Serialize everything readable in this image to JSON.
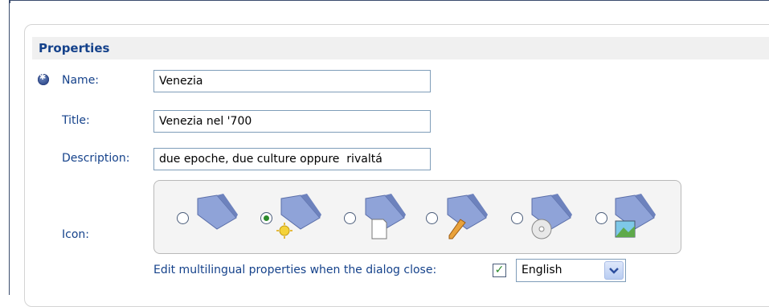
{
  "section": {
    "title": "Properties"
  },
  "fields": {
    "name": {
      "label": "Name:",
      "value": "Venezia"
    },
    "title": {
      "label": "Title:",
      "value": "Venezia nel '700"
    },
    "description": {
      "label": "Description:",
      "value": "due epoche, due culture oppure  rivaltá"
    }
  },
  "icon": {
    "label": "Icon:",
    "options": [
      {
        "name": "folder-icon",
        "selected": false
      },
      {
        "name": "folder-sun-icon",
        "selected": true
      },
      {
        "name": "folder-document-icon",
        "selected": false
      },
      {
        "name": "folder-pencil-icon",
        "selected": false
      },
      {
        "name": "folder-disc-icon",
        "selected": false
      },
      {
        "name": "folder-image-icon",
        "selected": false
      }
    ]
  },
  "multilingual": {
    "label": "Edit multilingual properties when the dialog close:",
    "checked": true,
    "language": "English"
  },
  "colors": {
    "label": "#15428b",
    "header_bg": "#f0f0f0",
    "field_border": "#7f9db9"
  }
}
